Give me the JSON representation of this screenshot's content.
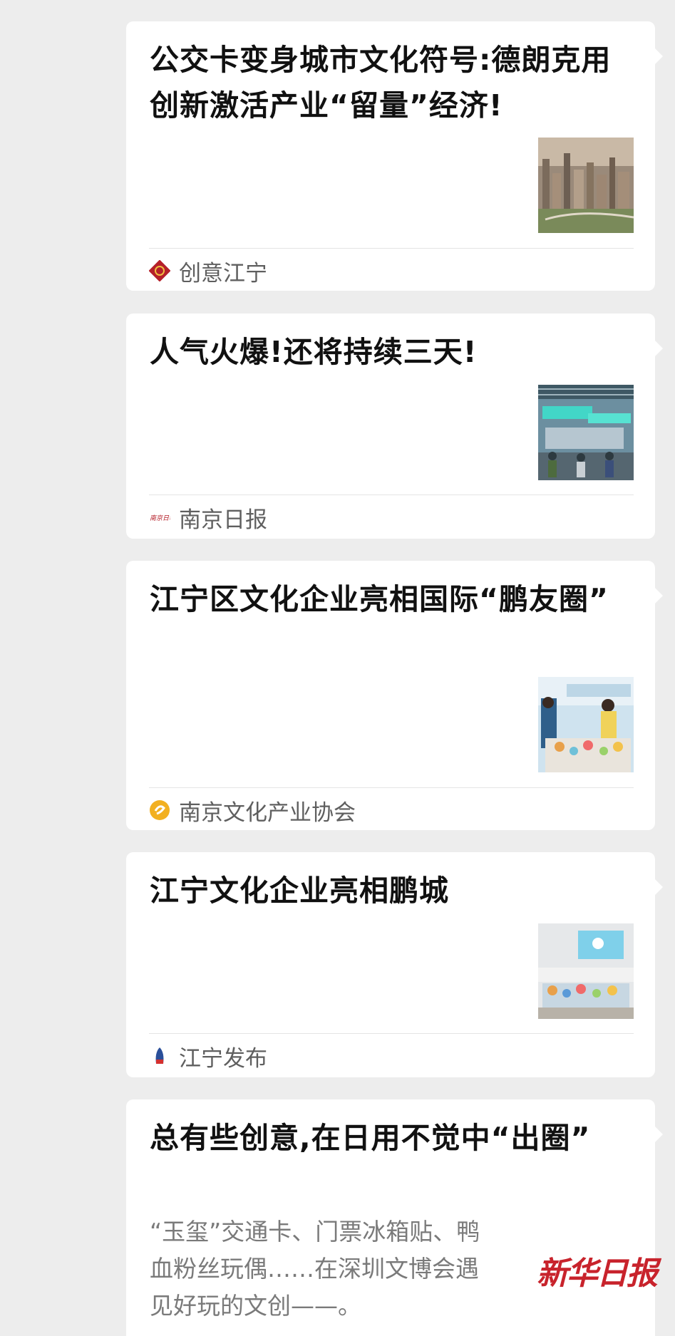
{
  "articles": [
    {
      "title": "公交卡变身城市文化符号:德朗克用创新激活产业“留量”经济!",
      "source": "创意江宁",
      "thumb_icon": "city-skyline-photo",
      "source_icon": "chuangyi-jiangning-logo-icon"
    },
    {
      "title": "人气火爆!还将持续三天!",
      "source": "南京日报",
      "thumb_icon": "exhibition-hall-photo",
      "source_icon": "nanjing-daily-logo-icon"
    },
    {
      "title": "江宁区文化企业亮相国际“鹏友圈”",
      "source": "南京文化产业协会",
      "thumb_icon": "exhibition-booth-photo",
      "source_icon": "nanjing-culture-association-logo-icon"
    },
    {
      "title": "江宁文化企业亮相鹏城",
      "source": "江宁发布",
      "thumb_icon": "product-display-photo",
      "source_icon": "jiangning-release-logo-icon"
    },
    {
      "title": "总有些创意,在日用不觉中“出圈”",
      "description": "“玉玺”交通卡、门票冰箱贴、鸭血粉丝玩偶……在深圳文博会遇见好玩的文创——。",
      "logo_text": "新华日报"
    }
  ],
  "colors": {
    "background": "#ededed",
    "card": "#ffffff",
    "title": "#111111",
    "source": "#5f5f5f",
    "description": "#7a7a7a",
    "logo_red": "#c8232c"
  }
}
